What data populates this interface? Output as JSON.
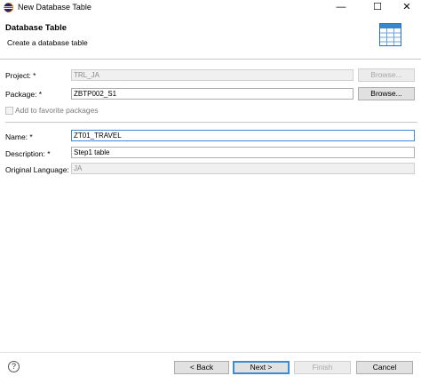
{
  "window": {
    "title": "New Database Table",
    "minimize_glyph": "—",
    "maximize_glyph": "☐",
    "close_glyph": "✕"
  },
  "header": {
    "title": "Database Table",
    "subtitle": "Create a database table",
    "icon": "table-icon"
  },
  "form": {
    "project": {
      "label": "Project: *",
      "value": "TRL_JA",
      "browse": "Browse..."
    },
    "package": {
      "label": "Package: *",
      "value": "ZBTP002_S1",
      "browse": "Browse..."
    },
    "favorite": {
      "label": "Add to favorite packages",
      "checked": false
    },
    "name": {
      "label": "Name: *",
      "value": "ZT01_TRAVEL"
    },
    "description": {
      "label": "Description: *",
      "value": "Step1 table"
    },
    "language": {
      "label": "Original Language:",
      "value": "JA"
    }
  },
  "footer": {
    "help": "?",
    "back": "< Back",
    "next": "Next >",
    "finish": "Finish",
    "cancel": "Cancel"
  }
}
